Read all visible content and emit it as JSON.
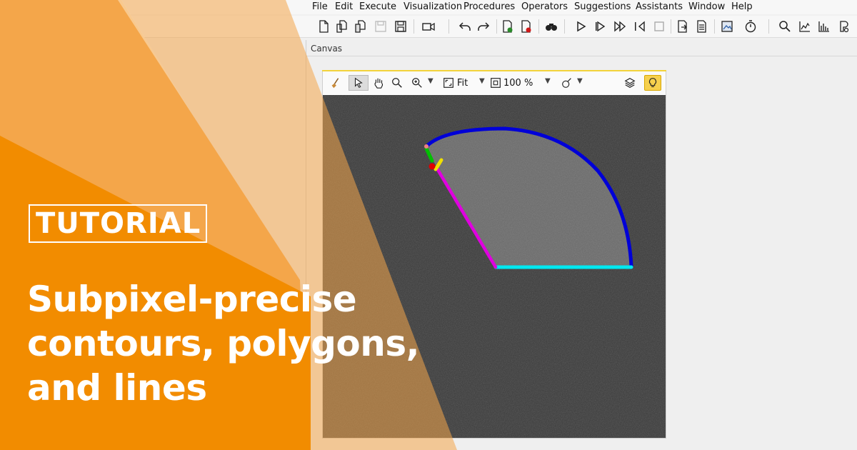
{
  "menu": {
    "items": [
      "File",
      "Edit",
      "Execute",
      "Visualization",
      "Procedures",
      "Operators",
      "Suggestions",
      "Assistants",
      "Window",
      "Help"
    ]
  },
  "toolbar": {
    "icons": [
      "new-file-icon",
      "open-icon",
      "open-example-icon",
      "save-disabled-icon",
      "save-icon",
      "record-icon",
      "undo-icon",
      "redo-icon",
      "insert-breakpoint-icon",
      "clear-breakpoint-icon",
      "find-icon",
      "run-icon",
      "step-over-icon",
      "step-into-icon",
      "step-out-icon",
      "stop-icon",
      "export-icon",
      "report-icon",
      "image-icon",
      "profiler-icon",
      "zoom-icon",
      "histogram-icon",
      "line-profile-icon",
      "feature-icon"
    ]
  },
  "canvas": {
    "title": "Canvas"
  },
  "graphics_window": {
    "fit_label": "Fit",
    "zoom_label": "100 %",
    "tools": [
      "clear-icon",
      "pointer-icon",
      "pan-icon",
      "zoom-icon",
      "zoom-in-icon",
      "fit-icon",
      "zoom-level-icon",
      "draw-icon",
      "layers-icon",
      "bulb-icon"
    ]
  },
  "contours": {
    "arc_color": "#0000d8",
    "base_line_color": "#00e8f0",
    "side_line_color": "#e000e0",
    "small_green_color": "#00c000",
    "small_yellow_color": "#f0e000",
    "small_red_color": "#e00000",
    "region_color": "#6a6a6a",
    "background_color": "#3a3a3a"
  },
  "overlay": {
    "tag": "TUTORIAL",
    "headline_lines": [
      "Subpixel-precise",
      "contours, polygons,",
      "and lines"
    ],
    "orange_dark": "#f28c00",
    "orange_mid": "#f4a64a",
    "orange_light": "#f8c98f"
  }
}
